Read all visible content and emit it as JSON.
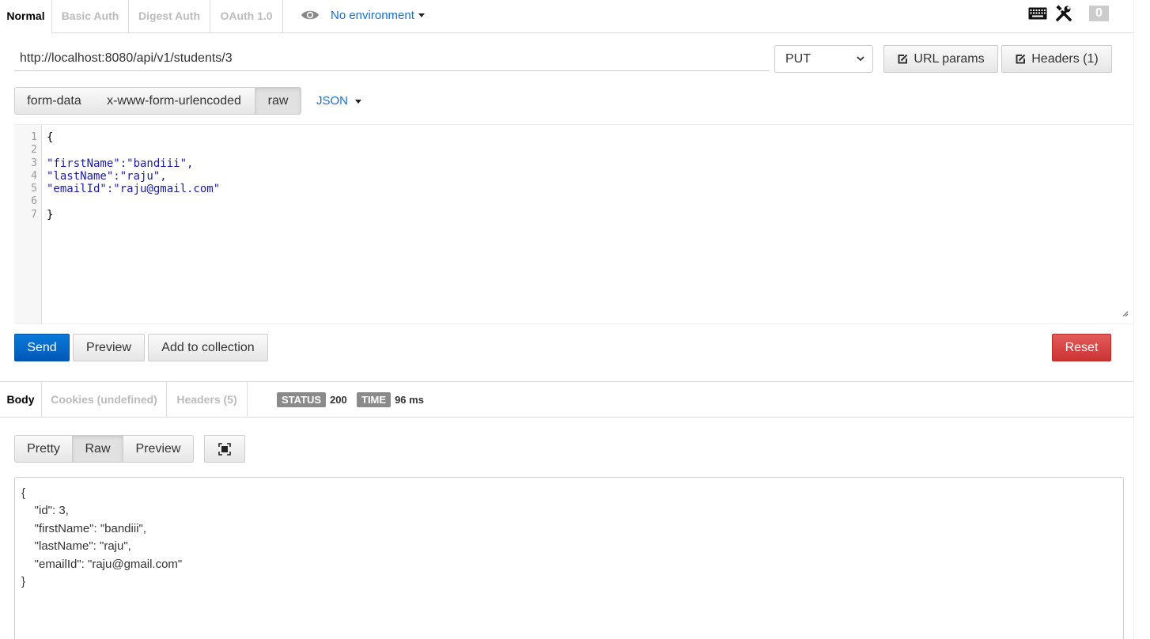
{
  "auth_tabs": [
    {
      "label": "Normal",
      "active": true
    },
    {
      "label": "Basic Auth",
      "active": false
    },
    {
      "label": "Digest Auth",
      "active": false
    },
    {
      "label": "OAuth 1.0",
      "active": false
    }
  ],
  "environment": {
    "label": "No environment"
  },
  "toolbar": {
    "badge_count": "0"
  },
  "request": {
    "url": "http://localhost:8080/api/v1/students/3",
    "method": "PUT",
    "url_params_label": "URL params",
    "headers_label": "Headers (1)"
  },
  "body_types": [
    {
      "label": "form-data",
      "active": false
    },
    {
      "label": "x-www-form-urlencoded",
      "active": false
    },
    {
      "label": "raw",
      "active": true
    }
  ],
  "body_format": "JSON",
  "editor": {
    "line_numbers": [
      "1",
      "2",
      "3",
      "4",
      "5",
      "6",
      "7"
    ],
    "lines": [
      "{",
      "",
      "\"firstName\":\"bandiii\",",
      "\"lastName\":\"raju\",",
      "\"emailId\":\"raju@gmail.com\"",
      "",
      "}"
    ]
  },
  "actions": {
    "send": "Send",
    "preview": "Preview",
    "add_to_collection": "Add to collection",
    "reset": "Reset"
  },
  "response_tabs": [
    {
      "label": "Body",
      "active": true
    },
    {
      "label": "Cookies (undefined)",
      "active": false
    },
    {
      "label": "Headers (5)",
      "active": false
    }
  ],
  "response_status": {
    "status_label": "STATUS",
    "status_value": "200",
    "time_label": "TIME",
    "time_value": "96 ms"
  },
  "view_modes": [
    {
      "label": "Pretty",
      "active": false
    },
    {
      "label": "Raw",
      "active": true
    },
    {
      "label": "Preview",
      "active": false
    }
  ],
  "response_body": [
    "{",
    "    \"id\": 3,",
    "    \"firstName\": \"bandiii\",",
    "    \"lastName\": \"raju\",",
    "    \"emailId\": \"raju@gmail.com\"",
    "}"
  ],
  "colors": {
    "link": "#1a6fc9",
    "send": "#0066cc",
    "reset": "#d9413f",
    "pill": "#8a8a8a"
  }
}
